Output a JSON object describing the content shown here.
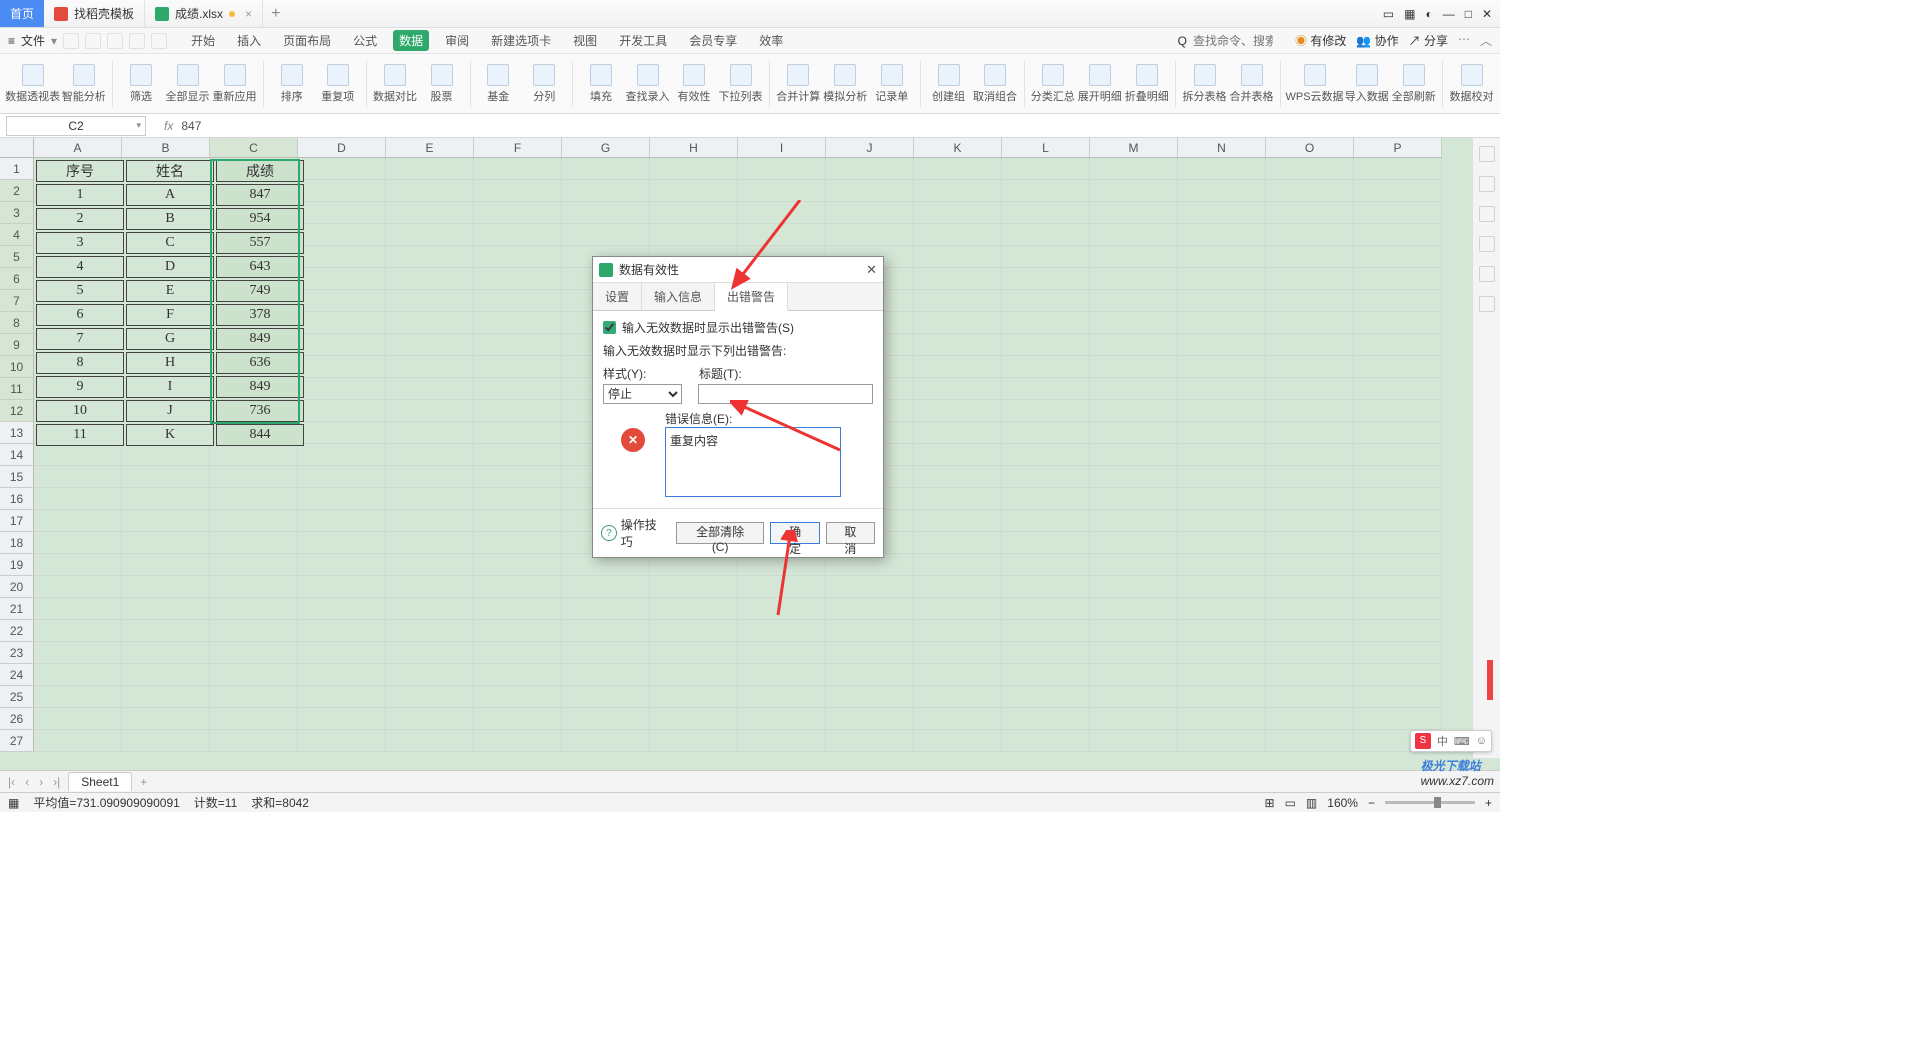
{
  "titlebar": {
    "home": "首页",
    "tab1": "找稻壳模板",
    "tab2": "成绩.xlsx"
  },
  "menu": {
    "file": "文件",
    "tabs": [
      "开始",
      "插入",
      "页面布局",
      "公式",
      "数据",
      "审阅",
      "新建选项卡",
      "视图",
      "开发工具",
      "会员专享",
      "效率"
    ],
    "active_index": 4,
    "search_ico": "Q",
    "search_placeholder": "查找命令、搜索模板",
    "right": {
      "unsaved": "有修改",
      "coop": "协作",
      "share": "分享"
    }
  },
  "ribbon": {
    "items": [
      "数据透视表",
      "智能分析",
      "筛选",
      "全部显示",
      "重新应用",
      "排序",
      "重复项",
      "数据对比",
      "股票",
      "基金",
      "分列",
      "填充",
      "查找录入",
      "有效性",
      "下拉列表",
      "合并计算",
      "模拟分析",
      "记录单",
      "创建组",
      "取消组合",
      "分类汇总",
      "展开明细",
      "折叠明细",
      "拆分表格",
      "合并表格",
      "WPS云数据",
      "导入数据",
      "全部刷新",
      "数据校对"
    ]
  },
  "formula": {
    "cell": "C2",
    "value": "847"
  },
  "columns": [
    "A",
    "B",
    "C",
    "D",
    "E",
    "F",
    "G",
    "H",
    "I",
    "J",
    "K",
    "L",
    "M",
    "N",
    "O",
    "P"
  ],
  "table": {
    "headers": [
      "序号",
      "姓名",
      "成绩"
    ],
    "rows": [
      [
        "1",
        "A",
        "847"
      ],
      [
        "2",
        "B",
        "954"
      ],
      [
        "3",
        "C",
        "557"
      ],
      [
        "4",
        "D",
        "643"
      ],
      [
        "5",
        "E",
        "749"
      ],
      [
        "6",
        "F",
        "378"
      ],
      [
        "7",
        "G",
        "849"
      ],
      [
        "8",
        "H",
        "636"
      ],
      [
        "9",
        "I",
        "849"
      ],
      [
        "10",
        "J",
        "736"
      ],
      [
        "11",
        "K",
        "844"
      ]
    ]
  },
  "dialog": {
    "title": "数据有效性",
    "tabs": [
      "设置",
      "输入信息",
      "出错警告"
    ],
    "active_tab": 2,
    "chk_label": "输入无效数据时显示出错警告(S)",
    "subtitle": "输入无效数据时显示下列出错警告:",
    "style_label": "样式(Y):",
    "style_value": "停止",
    "title_label": "标题(T):",
    "title_value": "",
    "msg_label": "错误信息(E):",
    "msg_value": "重复内容",
    "tip": "操作技巧",
    "clear": "全部清除(C)",
    "ok": "确定",
    "cancel": "取消"
  },
  "sheets": {
    "name": "Sheet1"
  },
  "status": {
    "avg": "平均值=731.090909090091",
    "count": "计数=11",
    "sum": "求和=8042",
    "zoom": "160%"
  },
  "watermark": {
    "a": "极光下载站",
    "b": "www.xz7.com"
  },
  "ime": {
    "label": "中"
  }
}
